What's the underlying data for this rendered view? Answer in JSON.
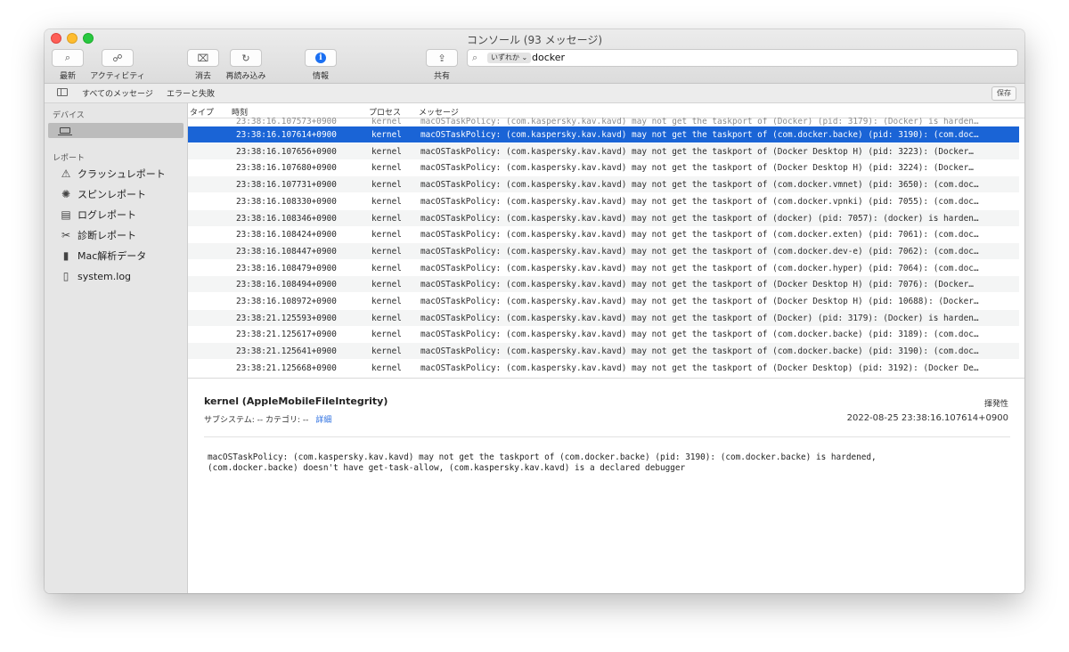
{
  "window": {
    "title": "コンソール (93 メッセージ)"
  },
  "toolbar": {
    "latest_label": "最新",
    "activity_label": "アクティビティ",
    "clear_label": "消去",
    "reload_label": "再読み込み",
    "info_label": "情報",
    "share_label": "共有",
    "search_scope": "いずれか ⌄",
    "search_value": "docker"
  },
  "filterbar": {
    "all_messages": "すべてのメッセージ",
    "errors_faults": "エラーと失敗",
    "save_label": "保存"
  },
  "sidebar": {
    "devices_label": "デバイス",
    "reports_label": "レポート",
    "items": [
      {
        "label": "クラッシュレポート",
        "icon": "warning-icon"
      },
      {
        "label": "スピンレポート",
        "icon": "spin-icon"
      },
      {
        "label": "ログレポート",
        "icon": "log-icon"
      },
      {
        "label": "診断レポート",
        "icon": "tools-icon"
      },
      {
        "label": "Mac解析データ",
        "icon": "chart-icon"
      },
      {
        "label": "system.log",
        "icon": "document-icon"
      }
    ]
  },
  "log": {
    "columns": {
      "type": "タイプ",
      "time": "時刻",
      "process": "プロセス",
      "message": "メッセージ"
    },
    "partial_row": {
      "time": "23:38:16.107573+0900",
      "process": "kernel",
      "message": "macOSTaskPolicy: (com.kaspersky.kav.kavd) may not get the taskport of (Docker) (pid: 3179): (Docker) is harden…"
    },
    "rows": [
      {
        "time": "23:38:16.107614+0900",
        "process": "kernel",
        "message": "macOSTaskPolicy: (com.kaspersky.kav.kavd) may not get the taskport of (com.docker.backe) (pid: 3190): (com.doc…"
      },
      {
        "time": "23:38:16.107656+0900",
        "process": "kernel",
        "message": "macOSTaskPolicy: (com.kaspersky.kav.kavd) may not get the taskport of (Docker Desktop H) (pid: 3223): (Docker…"
      },
      {
        "time": "23:38:16.107680+0900",
        "process": "kernel",
        "message": "macOSTaskPolicy: (com.kaspersky.kav.kavd) may not get the taskport of (Docker Desktop H) (pid: 3224): (Docker…"
      },
      {
        "time": "23:38:16.107731+0900",
        "process": "kernel",
        "message": "macOSTaskPolicy: (com.kaspersky.kav.kavd) may not get the taskport of (com.docker.vmnet) (pid: 3650): (com.doc…"
      },
      {
        "time": "23:38:16.108330+0900",
        "process": "kernel",
        "message": "macOSTaskPolicy: (com.kaspersky.kav.kavd) may not get the taskport of (com.docker.vpnki) (pid: 7055): (com.doc…"
      },
      {
        "time": "23:38:16.108346+0900",
        "process": "kernel",
        "message": "macOSTaskPolicy: (com.kaspersky.kav.kavd) may not get the taskport of (docker) (pid: 7057): (docker) is harden…"
      },
      {
        "time": "23:38:16.108424+0900",
        "process": "kernel",
        "message": "macOSTaskPolicy: (com.kaspersky.kav.kavd) may not get the taskport of (com.docker.exten) (pid: 7061): (com.doc…"
      },
      {
        "time": "23:38:16.108447+0900",
        "process": "kernel",
        "message": "macOSTaskPolicy: (com.kaspersky.kav.kavd) may not get the taskport of (com.docker.dev-e) (pid: 7062): (com.doc…"
      },
      {
        "time": "23:38:16.108479+0900",
        "process": "kernel",
        "message": "macOSTaskPolicy: (com.kaspersky.kav.kavd) may not get the taskport of (com.docker.hyper) (pid: 7064): (com.doc…"
      },
      {
        "time": "23:38:16.108494+0900",
        "process": "kernel",
        "message": "macOSTaskPolicy: (com.kaspersky.kav.kavd) may not get the taskport of (Docker Desktop H) (pid: 7076): (Docker…"
      },
      {
        "time": "23:38:16.108972+0900",
        "process": "kernel",
        "message": "macOSTaskPolicy: (com.kaspersky.kav.kavd) may not get the taskport of (Docker Desktop H) (pid: 10688): (Docker…"
      },
      {
        "time": "23:38:21.125593+0900",
        "process": "kernel",
        "message": "macOSTaskPolicy: (com.kaspersky.kav.kavd) may not get the taskport of (Docker) (pid: 3179): (Docker) is harden…"
      },
      {
        "time": "23:38:21.125617+0900",
        "process": "kernel",
        "message": "macOSTaskPolicy: (com.kaspersky.kav.kavd) may not get the taskport of (com.docker.backe) (pid: 3189): (com.doc…"
      },
      {
        "time": "23:38:21.125641+0900",
        "process": "kernel",
        "message": "macOSTaskPolicy: (com.kaspersky.kav.kavd) may not get the taskport of (com.docker.backe) (pid: 3190): (com.doc…"
      },
      {
        "time": "23:38:21.125668+0900",
        "process": "kernel",
        "message": "macOSTaskPolicy: (com.kaspersky.kav.kavd) may not get the taskport of (Docker Desktop) (pid: 3192): (Docker De…"
      }
    ]
  },
  "detail": {
    "title": "kernel (AppleMobileFileIntegrity)",
    "subsystem": "サブシステム: --  カテゴリ: --",
    "details_link": "詳細",
    "volatile": "揮発性",
    "timestamp": "2022-08-25 23:38:16.107614+0900",
    "body": "macOSTaskPolicy: (com.kaspersky.kav.kavd) may not get the taskport of (com.docker.backe) (pid: 3190): (com.docker.backe) is hardened,\n(com.docker.backe) doesn't have get-task-allow, (com.kaspersky.kav.kavd) is a declared debugger"
  },
  "colors": {
    "selection": "#1a64d6",
    "info_blue": "#1a6ff2",
    "link": "#2a6ee0"
  }
}
